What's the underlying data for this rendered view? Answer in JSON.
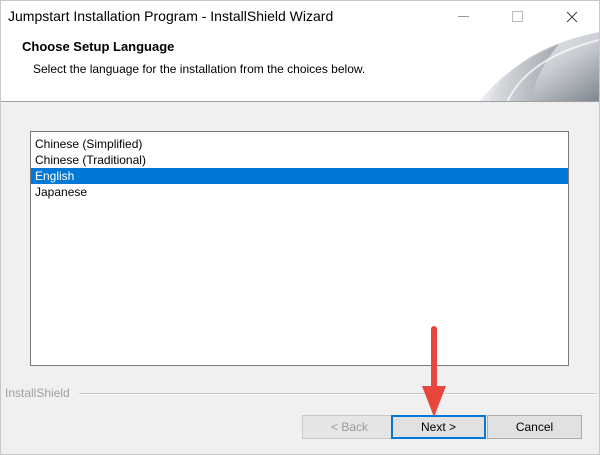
{
  "window": {
    "title": "Jumpstart Installation Program - InstallShield Wizard"
  },
  "header": {
    "title": "Choose Setup Language",
    "subtitle": "Select the language for the installation from the choices below."
  },
  "languages": {
    "items": [
      "Chinese (Simplified)",
      "Chinese (Traditional)",
      "English",
      "Japanese"
    ],
    "selected": "English"
  },
  "footer": {
    "brand": "InstallShield"
  },
  "buttons": {
    "back": "< Back",
    "next": "Next >",
    "cancel": "Cancel"
  },
  "icons": {
    "minimize": "minimize-icon",
    "maximize": "maximize-icon",
    "close": "close-icon",
    "arrow": "arrow-down-icon"
  },
  "colors": {
    "selection": "#0078d7",
    "annotation_arrow": "#e8463d"
  }
}
